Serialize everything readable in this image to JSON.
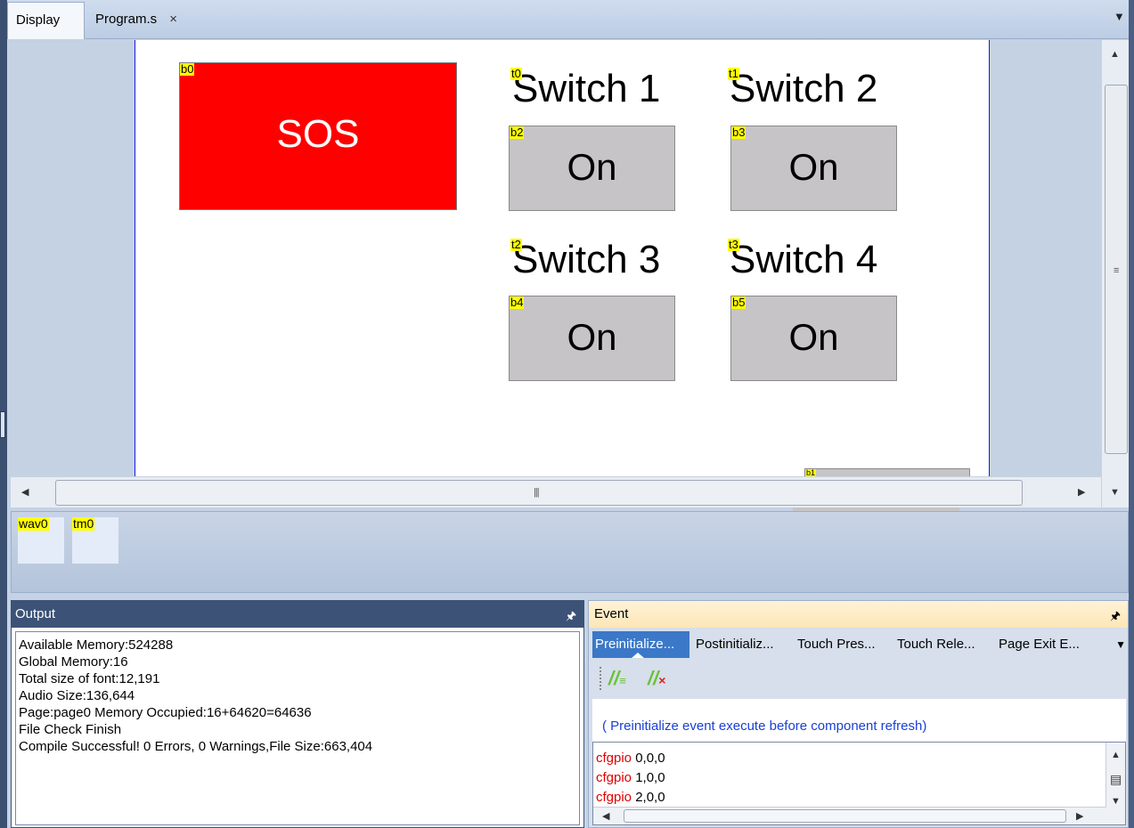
{
  "tabs": [
    {
      "label": "Display",
      "active": true
    },
    {
      "label": "Program.s",
      "active": false,
      "close": "×"
    }
  ],
  "canvas": {
    "sos": {
      "id": "b0",
      "text": "SOS",
      "bg": "#ff0000",
      "fg": "#ffffff"
    },
    "switches": [
      {
        "label_id": "t0",
        "label": "Switch 1",
        "button_id": "b2",
        "button": "On"
      },
      {
        "label_id": "t1",
        "label": "Switch 2",
        "button_id": "b3",
        "button": "On"
      },
      {
        "label_id": "t2",
        "label": "Switch 3",
        "button_id": "b4",
        "button": "On"
      },
      {
        "label_id": "t3",
        "label": "Switch 4",
        "button_id": "b5",
        "button": "On"
      }
    ],
    "partial_component": {
      "id": "b1"
    }
  },
  "tray": [
    {
      "id": "wav0"
    },
    {
      "id": "tm0"
    }
  ],
  "output": {
    "title": "Output",
    "lines": [
      "Available Memory:524288",
      "Global Memory:16",
      "Total size of font:12,191",
      "Audio Size:136,644",
      "Page:page0 Memory Occupied:16+64620=64636",
      "File Check Finish",
      "Compile Successful! 0 Errors, 0 Warnings,File Size:663,404"
    ]
  },
  "event": {
    "title": "Event",
    "tabs": [
      "Preinitialize...",
      "Postinitializ...",
      "Touch Pres...",
      "Touch Rele...",
      "Page Exit E..."
    ],
    "hint": "( Preinitialize event execute before component refresh)",
    "code": [
      {
        "kw": "cfgpio",
        "args": " 0,0,0"
      },
      {
        "kw": "cfgpio",
        "args": " 1,0,0"
      },
      {
        "kw": "cfgpio",
        "args": " 2,0,0"
      }
    ]
  },
  "colors": {
    "label_bg": "#ffff00",
    "button_bg": "#c6c4c6",
    "hint": "#1a40d6",
    "keyword": "#e00000"
  },
  "icons": {
    "comment": "comment-lines-icon",
    "uncomment": "uncomment-lines-icon"
  }
}
